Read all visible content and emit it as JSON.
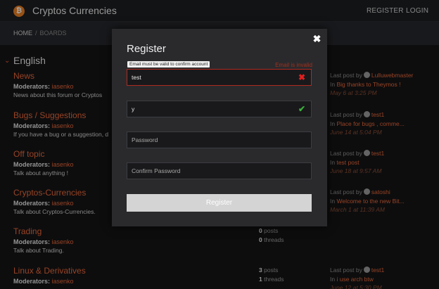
{
  "header": {
    "logo_glyph": "₿",
    "brand": "Cryptos Currencies",
    "nav": {
      "register": "REGISTER",
      "login": "LOGIN"
    }
  },
  "breadcrumb": {
    "home": "HOME",
    "separator": "/",
    "current": "BOARDS"
  },
  "category": {
    "chevron": "⌄",
    "title": "English"
  },
  "forums": [
    {
      "name": "News",
      "mod_label": "Moderators:",
      "moderator": "iasenko",
      "description": "News about this forum or Cryptos",
      "last": {
        "label": "Last post by",
        "user": "Lulluwebmaster",
        "in": "In",
        "topic": "Big thanks to Theymos !",
        "date": "May 6 at 3:25 PM"
      }
    },
    {
      "name": "Bugs / Suggestions",
      "mod_label": "Moderators:",
      "moderator": "iasenko",
      "description": "If you have a bug or a suggestion, d",
      "last": {
        "label": "Last post by",
        "user": "test1",
        "in": "In",
        "topic": "Place for bugs , comme...",
        "date": "June 14 at 5:04 PM"
      }
    },
    {
      "name": "Off topic",
      "mod_label": "Moderators:",
      "moderator": "iasenko",
      "description": "Talk about anything !",
      "last": {
        "label": "Last post by",
        "user": "test1",
        "in": "In",
        "topic": "test post",
        "date": "June 18 at 9:57 AM"
      }
    },
    {
      "name": "Cryptos-Currencies",
      "mod_label": "Moderators:",
      "moderator": "iasenko",
      "description": "Talk about Cryptos-Currencies.",
      "last": {
        "label": "Last post by",
        "user": "satoshi",
        "in": "In",
        "topic": "Welcome to the new Bit...",
        "date": "March 1 at 11:39 AM"
      }
    },
    {
      "name": "Trading",
      "mod_label": "Moderators:",
      "moderator": "iasenko",
      "description": "Talk about Trading.",
      "stats": {
        "posts_count": "0",
        "posts_label": "posts",
        "threads_count": "0",
        "threads_label": "threads"
      }
    },
    {
      "name": "Linux & Derivatives",
      "mod_label": "Moderators:",
      "moderator": "iasenko",
      "description": "",
      "stats": {
        "posts_count": "3",
        "posts_label": "posts",
        "threads_count": "1",
        "threads_label": "threads"
      },
      "last": {
        "label": "Last post by",
        "user": "test1",
        "in": "In",
        "topic": "i use arch btw",
        "date": "June 12 at 5:30 PM"
      }
    }
  ],
  "modal": {
    "title": "Register",
    "close_icon": "✖",
    "tooltip": "Email must be valid to confirm account",
    "error": "Email is invalid",
    "email_value": "test",
    "error_icon": "✖",
    "username_value": "y",
    "ok_icon": "✔",
    "password_placeholder": "Password",
    "confirm_placeholder": "Confirm Password",
    "submit": "Register"
  }
}
